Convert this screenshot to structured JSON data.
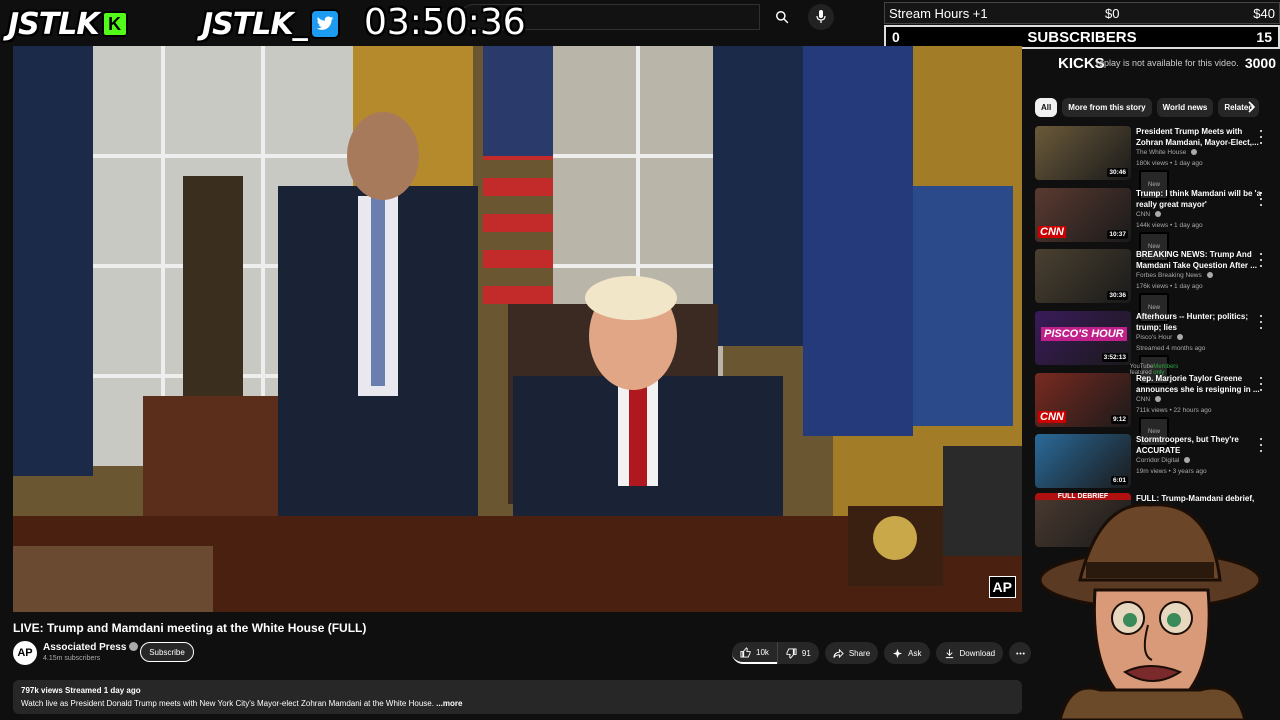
{
  "overlay": {
    "brand1": "JSTLK",
    "brand2": "JSTLK_",
    "kick_badge": "K",
    "timer": "03:50:36"
  },
  "stats": {
    "row1_a": "Stream Hours +1",
    "row1_b": "$0",
    "row1_c": "$40",
    "row2_a": "0",
    "row2_b": "SUBSCRIBERS",
    "row2_c": "15",
    "row3_pill": "0",
    "row3_b": "KICKS",
    "row3_note": "replay is not available for this video.",
    "row3_c": "3000"
  },
  "video": {
    "title": "LIVE: Trump and Mamdani meeting at the White House (FULL)",
    "watermark": "AP",
    "channel": "Associated Press",
    "channel_avatar": "AP",
    "subs": "4.15m subscribers",
    "subscribe": "Subscribe",
    "likes": "10k",
    "dislikes": "91",
    "share": "Share",
    "ask": "Ask",
    "download": "Download",
    "desc_meta": "797k views  Streamed 1 day ago",
    "desc_text": "Watch live as President Donald Trump meets with New York City's Mayor-elect Zohran Mamdani at the White House.",
    "desc_more": " ...more"
  },
  "chips": [
    "All",
    "More from this story",
    "World news",
    "Related"
  ],
  "recs": [
    {
      "title": "President Trump Meets with Zohran Mamdani, Mayor-Elect,...",
      "channel": "The White House",
      "meta": "180k views • 1 day ago",
      "badge": "New",
      "duration": "30:46",
      "color": "#6b5a3a"
    },
    {
      "title": "Trump: I think Mamdani will be 'a really great mayor'",
      "channel": "CNN",
      "meta": "144k views • 1 day ago",
      "badge": "New",
      "duration": "10:37",
      "color": "#5a3a30"
    },
    {
      "title": "BREAKING NEWS: Trump And Mamdani Take Question After ...",
      "channel": "Forbes Breaking News",
      "meta": "176k views • 1 day ago",
      "badge": "New",
      "duration": "30:36",
      "color": "#4a4030"
    },
    {
      "title": "Afterhours -- Hunter; politics; trump; lies",
      "channel": "Pisco's Hour",
      "meta": "Streamed 4 months ago",
      "badge": "YouTube featured",
      "badge2": "Members only",
      "duration": "3:52:13",
      "color": "#3a1a5a"
    },
    {
      "title": "Rep. Marjorie Taylor Greene announces she is resigning in ...",
      "channel": "CNN",
      "meta": "711k views • 22 hours ago",
      "badge": "New",
      "duration": "9:12",
      "color": "#7a2a20"
    },
    {
      "title": "Stormtroopers, but They're ACCURATE",
      "channel": "Corridor Digital",
      "meta": "19m views • 3 years ago",
      "badge": "",
      "duration": "6:01",
      "color": "#2a6a9a"
    },
    {
      "title": "FULL: Trump-Mamdani debrief,",
      "channel": "",
      "meta": "",
      "badge": "",
      "duration": "",
      "color": "#4a3a30"
    }
  ],
  "thumb_labels": {
    "full_debrief": "FULL DEBRIEF",
    "piscos": "PISCO'S HOUR",
    "cnn": "CNN"
  }
}
